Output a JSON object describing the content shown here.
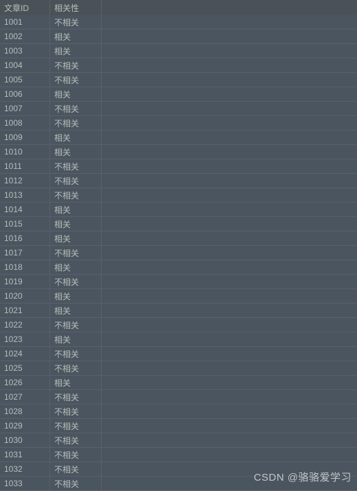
{
  "headers": {
    "id": "文章ID",
    "rel": "相关性"
  },
  "rows": [
    {
      "id": "1001",
      "rel": "不相关"
    },
    {
      "id": "1002",
      "rel": "相关"
    },
    {
      "id": "1003",
      "rel": "相关"
    },
    {
      "id": "1004",
      "rel": "不相关"
    },
    {
      "id": "1005",
      "rel": "不相关"
    },
    {
      "id": "1006",
      "rel": "相关"
    },
    {
      "id": "1007",
      "rel": "不相关"
    },
    {
      "id": "1008",
      "rel": "不相关"
    },
    {
      "id": "1009",
      "rel": "相关"
    },
    {
      "id": "1010",
      "rel": "相关"
    },
    {
      "id": "1011",
      "rel": "不相关"
    },
    {
      "id": "1012",
      "rel": "不相关"
    },
    {
      "id": "1013",
      "rel": "不相关"
    },
    {
      "id": "1014",
      "rel": "相关"
    },
    {
      "id": "1015",
      "rel": "相关"
    },
    {
      "id": "1016",
      "rel": "相关"
    },
    {
      "id": "1017",
      "rel": "不相关"
    },
    {
      "id": "1018",
      "rel": "相关"
    },
    {
      "id": "1019",
      "rel": "不相关"
    },
    {
      "id": "1020",
      "rel": "相关"
    },
    {
      "id": "1021",
      "rel": "相关"
    },
    {
      "id": "1022",
      "rel": "不相关"
    },
    {
      "id": "1023",
      "rel": "相关"
    },
    {
      "id": "1024",
      "rel": "不相关"
    },
    {
      "id": "1025",
      "rel": "不相关"
    },
    {
      "id": "1026",
      "rel": "相关"
    },
    {
      "id": "1027",
      "rel": "不相关"
    },
    {
      "id": "1028",
      "rel": "不相关"
    },
    {
      "id": "1029",
      "rel": "不相关"
    },
    {
      "id": "1030",
      "rel": "不相关"
    },
    {
      "id": "1031",
      "rel": "不相关"
    },
    {
      "id": "1032",
      "rel": "不相关"
    },
    {
      "id": "1033",
      "rel": "不相关"
    }
  ],
  "watermark": "CSDN @骆骆爱学习"
}
